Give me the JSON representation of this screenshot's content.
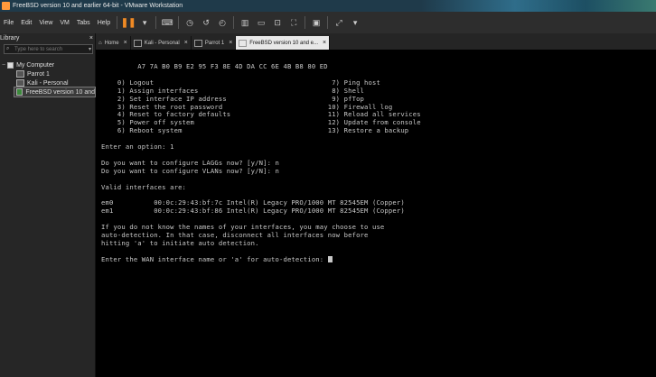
{
  "window": {
    "title": "FreeBSD version 10 and earlier 64-bit - VMware Workstation",
    "app_icon": "vmware-icon",
    "accent_color": "#f08a24"
  },
  "menubar": {
    "items": [
      "File",
      "Edit",
      "View",
      "VM",
      "Tabs",
      "Help"
    ],
    "toolbar_icons": [
      "pause-icon",
      "dropdown-icon",
      "send-keys-icon",
      "snapshot-icon",
      "revert-snapshot-icon",
      "manage-snapshots-icon",
      "library-view-icon",
      "thumbnail-view-icon",
      "fit-guest-icon",
      "fullscreen-icon",
      "console-view-icon",
      "stretch-icon"
    ]
  },
  "library": {
    "title": "Library",
    "close": "×",
    "search_placeholder": "Type here to search",
    "tree": {
      "root": "My Computer",
      "items": [
        "Parrot 1",
        "Kali - Personal",
        "FreeBSD version 10 and"
      ]
    }
  },
  "tabs": [
    {
      "label": "Home",
      "active": false
    },
    {
      "label": "Kali - Personal",
      "active": false
    },
    {
      "label": "Parrot 1",
      "active": false
    },
    {
      "label": "FreeBSD version 10 and e...",
      "active": true
    }
  ],
  "tab_close": "×",
  "console": {
    "mac": "A7 7A B0 B9 E2 95 F3 8E 4D DA CC 6E 4B B8 80 ED",
    "menu_left": [
      "0) Logout",
      "1) Assign interfaces",
      "2) Set interface IP address",
      "3) Reset the root password",
      "4) Reset to factory defaults",
      "5) Power off system",
      "6) Reboot system"
    ],
    "menu_right": [
      "7) Ping host",
      "8) Shell",
      "9) pfTop",
      "10) Firewall log",
      "11) Reload all services",
      "12) Update from console",
      "13) Restore a backup"
    ],
    "option_prompt": "Enter an option: 1",
    "lagg_prompt": "Do you want to configure LAGGs now? [y/N]: n",
    "vlan_prompt": "Do you want to configure VLANs now? [y/N]: n",
    "valid_header": "Valid interfaces are:",
    "interfaces": [
      {
        "name": "em0",
        "mac": "00:0c:29:43:bf:7c",
        "desc": "Intel(R) Legacy PRO/1000 MT 82545EM (Copper)"
      },
      {
        "name": "em1",
        "mac": "00:0c:29:43:bf:86",
        "desc": "Intel(R) Legacy PRO/1000 MT 82545EM (Copper)"
      }
    ],
    "help_lines": [
      "If you do not know the names of your interfaces, you may choose to use",
      "auto-detection. In that case, disconnect all interfaces now before",
      "hitting 'a' to initiate auto detection."
    ],
    "wan_prompt": "Enter the WAN interface name or 'a' for auto-detection: "
  }
}
